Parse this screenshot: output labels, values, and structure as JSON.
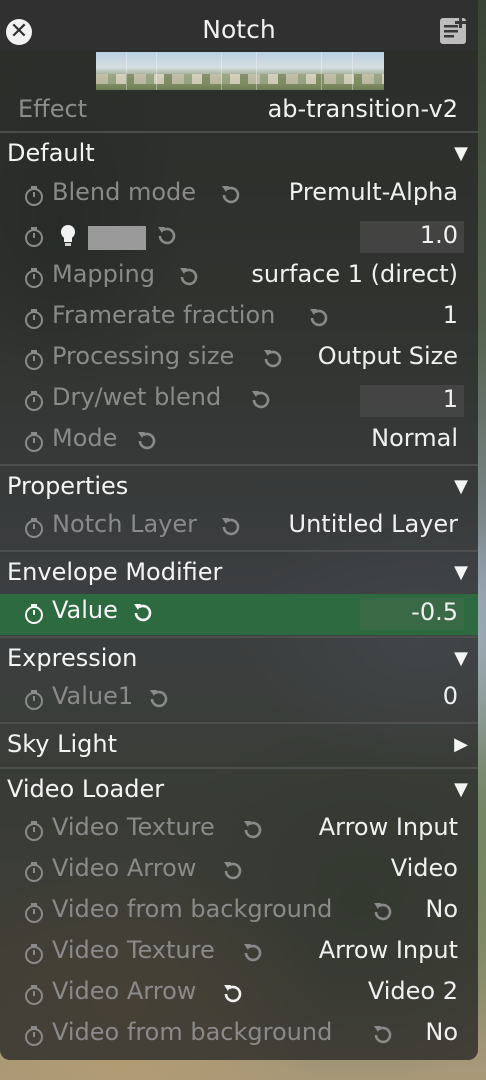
{
  "window": {
    "title": "Notch"
  },
  "effect": {
    "label": "Effect",
    "value": "ab-transition-v2"
  },
  "sections": {
    "default": {
      "name": "Default",
      "blend_mode": {
        "label": "Blend mode",
        "value": "Premult-Alpha"
      },
      "color_row": {
        "value": "1.0"
      },
      "mapping": {
        "label": "Mapping",
        "value": "surface 1 (direct)"
      },
      "framerate": {
        "label": "Framerate fraction",
        "value": "1"
      },
      "processing": {
        "label": "Processing size",
        "value": "Output Size"
      },
      "drywet": {
        "label": "Dry/wet blend",
        "value": "1"
      },
      "mode": {
        "label": "Mode",
        "value": "Normal"
      }
    },
    "properties": {
      "name": "Properties",
      "notch_layer": {
        "label": "Notch Layer",
        "value": "Untitled Layer"
      }
    },
    "envelope": {
      "name": "Envelope Modifier",
      "value": {
        "label": "Value",
        "value": "-0.5"
      }
    },
    "expression": {
      "name": "Expression",
      "value1": {
        "label": "Value1",
        "value": "0"
      }
    },
    "skylight": {
      "name": "Sky Light"
    },
    "video_loader": {
      "name": "Video Loader",
      "items": [
        {
          "label": "Video Texture",
          "value": "Arrow Input"
        },
        {
          "label": "Video Arrow",
          "value": "Video"
        },
        {
          "label": "Video from background",
          "value": "No"
        },
        {
          "label": "Video Texture",
          "value": "Arrow Input"
        },
        {
          "label": "Video Arrow",
          "value": "Video 2"
        },
        {
          "label": "Video from background",
          "value": "No"
        }
      ]
    }
  },
  "icons": {
    "close": "close-icon",
    "notes": "notes-add-icon",
    "timer": "stopwatch-icon",
    "reset": "reset-icon",
    "bulb": "lightbulb-icon",
    "expanded": "triangle-down-icon",
    "collapsed": "triangle-right-icon"
  },
  "colors": {
    "highlight": "#2e6a3f",
    "panel": "#262626",
    "swatch": "#9a9a9a"
  }
}
